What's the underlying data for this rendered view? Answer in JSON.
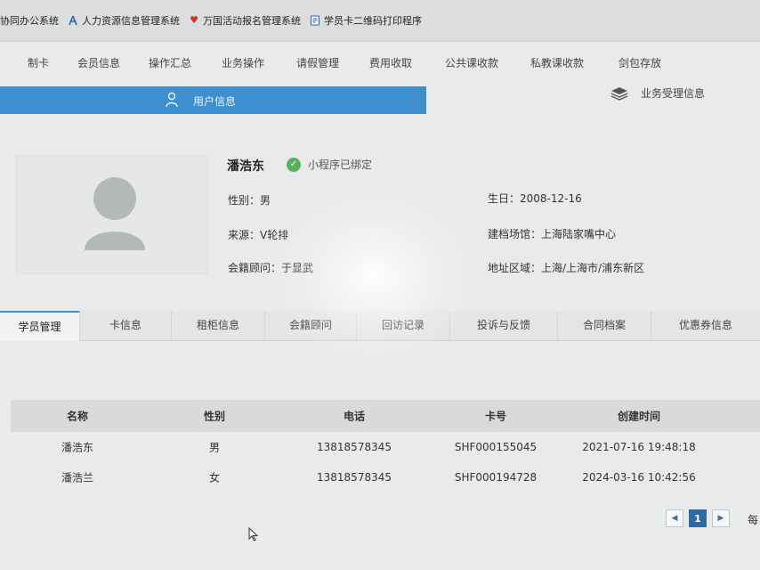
{
  "bookmarks": [
    {
      "label": "协同办公系统",
      "icon": "none"
    },
    {
      "label": "人力资源信息管理系统",
      "icon": "person-icon"
    },
    {
      "label": "万国活动报名管理系统",
      "icon": "heart-icon"
    },
    {
      "label": "学员卡二维码打印程序",
      "icon": "document-icon"
    }
  ],
  "nav": [
    "制卡",
    "会员信息",
    "操作汇总",
    "业务操作",
    "请假管理",
    "费用收取",
    "公共课收款",
    "私教课收款",
    "剑包存放"
  ],
  "user_bar": {
    "label": "用户信息"
  },
  "biz_info": {
    "label": "业务受理信息"
  },
  "profile": {
    "name": "潘浩东",
    "mini_program": "小程序已绑定",
    "gender": "性别：男",
    "birthday": "生日：2008-12-16",
    "source": "来源：V轮排",
    "venue": "建档场馆：上海陆家嘴中心",
    "advisor": "会籍顾问：于显武",
    "region": "地址区域：上海/上海市/浦东新区"
  },
  "tabs": [
    "学员管理",
    "卡信息",
    "租柜信息",
    "会籍顾问",
    "回访记录",
    "投诉与反馈",
    "合同档案",
    "优惠券信息"
  ],
  "table": {
    "headers": [
      "名称",
      "性别",
      "电话",
      "卡号",
      "创建时间"
    ],
    "rows": [
      [
        "潘浩东",
        "男",
        "13818578345",
        "SHF000155045",
        "2021-07-16 19:48:18"
      ],
      [
        "潘浩兰",
        "女",
        "13818578345",
        "SHF000194728",
        "2024-03-16 10:42:56"
      ]
    ]
  },
  "pagination": {
    "prev": "◀",
    "current": "1",
    "next": "▶",
    "per_page_text": "每"
  },
  "colors": {
    "accent": "#3d8fd0",
    "badge_green": "#58b158",
    "page_active": "#2f6aa3"
  }
}
